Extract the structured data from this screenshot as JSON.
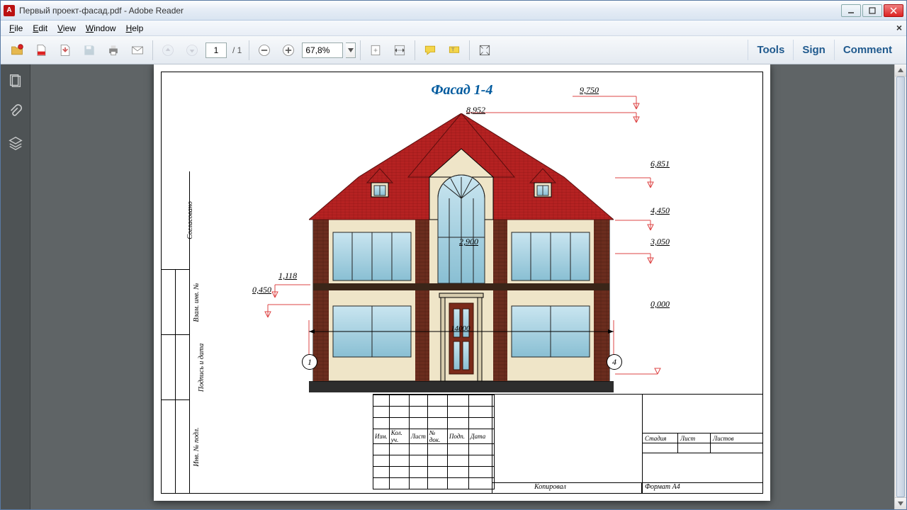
{
  "window": {
    "title": "Первый проект-фасад.pdf - Adobe Reader"
  },
  "menu": {
    "file": "File",
    "edit": "Edit",
    "view": "View",
    "window": "Window",
    "help": "Help"
  },
  "toolbar": {
    "page_current": "1",
    "page_count": "/ 1",
    "zoom_value": "67,8%"
  },
  "right_tools": {
    "tools": "Tools",
    "sign": "Sign",
    "comment": "Comment"
  },
  "drawing": {
    "title": "Фасад 1-4",
    "dimensions": {
      "top_right": "9,750",
      "ridge": "8,952",
      "eave": "6,851",
      "floor2_top": "4,450",
      "floor2_bot": "3,050",
      "center_door": "2,900",
      "left_top": "1,118",
      "left_bot": "0,450",
      "ground": "0,000",
      "width": "14000"
    },
    "axes": {
      "left": "1",
      "right": "4"
    }
  },
  "stamp": {
    "side_labels": [
      "Согласовано",
      "Взам. инв. №",
      "Подпись и дата",
      "Инв. № подл."
    ],
    "left_headers": [
      "Изм.",
      "Кол. уч.",
      "Лист",
      "№ док.",
      "Подп.",
      "Дата"
    ],
    "right_headers": [
      "Стадия",
      "Лист",
      "Листов"
    ],
    "bottom": {
      "kopiroval": "Копировал",
      "format": "Формат А4"
    }
  }
}
